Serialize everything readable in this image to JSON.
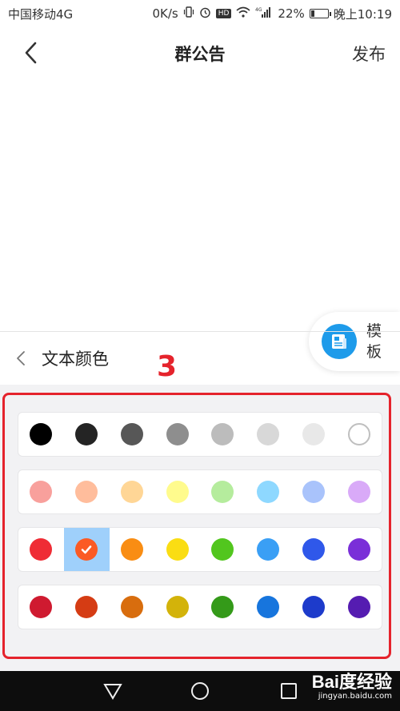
{
  "status_bar": {
    "carrier": "中国移动4G",
    "net_speed": "0K/s",
    "hd": "HD",
    "signal_label": "4G",
    "battery_pct": "22%",
    "battery_level": 0.22,
    "time": "晚上10:19"
  },
  "nav": {
    "title": "群公告",
    "publish_label": "发布"
  },
  "template": {
    "label": "模板"
  },
  "color_panel": {
    "title": "文本颜色",
    "annotation": "3",
    "rows": [
      [
        "#000000",
        "#242424",
        "#575757",
        "#8e8e8e",
        "#bcbcbc",
        "#d8d8d8",
        "#e8e8e8",
        "#ffffff"
      ],
      [
        "#f8a09c",
        "#ffbd9c",
        "#ffd696",
        "#fffb8d",
        "#b5ec9d",
        "#8ed8ff",
        "#a9c3fb",
        "#d9aaf8"
      ],
      [
        "#ef2c35",
        "#fb5a24",
        "#f98d13",
        "#fadd13",
        "#52c61e",
        "#3a9ff5",
        "#2f58ea",
        "#7a2fd8"
      ],
      [
        "#cf1a30",
        "#d53c14",
        "#d86d0e",
        "#d3b30a",
        "#349a19",
        "#1775dd",
        "#1d3bcb",
        "#551cb1"
      ]
    ],
    "selected": {
      "row": 2,
      "col": 1
    }
  },
  "watermark": {
    "main": "Bai度经验",
    "sub": "jingyan.baidu.com"
  }
}
